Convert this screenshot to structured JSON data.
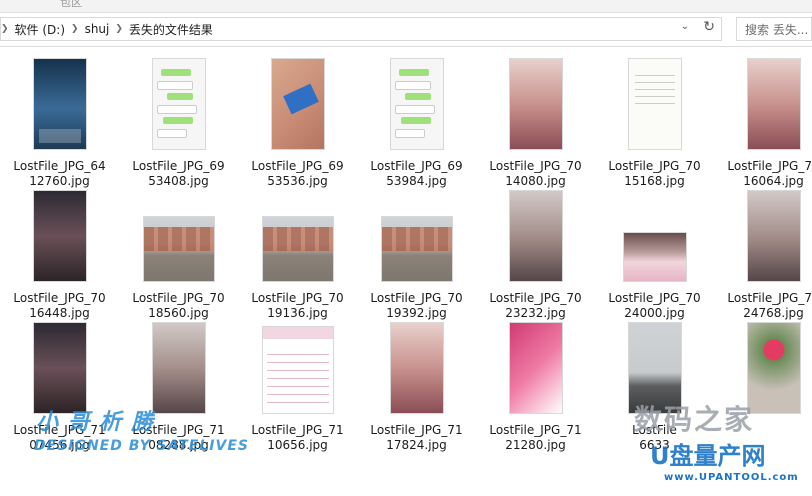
{
  "window": {
    "title_partial": "包区"
  },
  "address_bar": {
    "crumbs": [
      "软件 (D:)",
      "shuj",
      "丢失的文件结果"
    ],
    "dropdown_icon": "chevron-down-icon",
    "refresh_icon": "refresh-icon"
  },
  "search": {
    "placeholder": "搜索 丢失..."
  },
  "files": [
    {
      "line1": "LostFile_JPG_64",
      "line2": "12760.jpg",
      "art": "t-phone"
    },
    {
      "line1": "LostFile_JPG_69",
      "line2": "53408.jpg",
      "art": "t-chat"
    },
    {
      "line1": "LostFile_JPG_69",
      "line2": "53536.jpg",
      "art": "t-skin"
    },
    {
      "line1": "LostFile_JPG_69",
      "line2": "53984.jpg",
      "art": "t-chat"
    },
    {
      "line1": "LostFile_JPG_70",
      "line2": "14080.jpg",
      "art": "t-portrait"
    },
    {
      "line1": "LostFile_JPG_70",
      "line2": "15168.jpg",
      "art": "t-doc"
    },
    {
      "line1": "LostFile_JPG_70",
      "line2": "16064.jpg",
      "art": "t-portrait"
    },
    {
      "line1": "LostFile_JPG_70",
      "line2": "16448.jpg",
      "art": "t-dark"
    },
    {
      "line1": "LostFile_JPG_70",
      "line2": "18560.jpg",
      "art": "t-street"
    },
    {
      "line1": "LostFile_JPG_70",
      "line2": "19136.jpg",
      "art": "t-street"
    },
    {
      "line1": "LostFile_JPG_70",
      "line2": "19392.jpg",
      "art": "t-street"
    },
    {
      "line1": "LostFile_JPG_70",
      "line2": "23232.jpg",
      "art": "t-portrait2"
    },
    {
      "line1": "LostFile_JPG_70",
      "line2": "24000.jpg",
      "art": "t-kitty"
    },
    {
      "line1": "LostFile_JPG_70",
      "line2": "24768.jpg",
      "art": "t-portrait2"
    },
    {
      "line1": "LostFile_JPG_71",
      "line2": "07456.jpg",
      "art": "t-dark"
    },
    {
      "line1": "LostFile_JPG_71",
      "line2": "08288.jpg",
      "art": "t-portrait2"
    },
    {
      "line1": "LostFile_JPG_71",
      "line2": "10656.jpg",
      "art": "t-table"
    },
    {
      "line1": "LostFile_JPG_71",
      "line2": "17824.jpg",
      "art": "t-portrait"
    },
    {
      "line1": "LostFile_JPG_71",
      "line2": "21280.jpg",
      "art": "t-pink"
    },
    {
      "line1": "LostFile",
      "line2": "6633",
      "art": "t-road"
    },
    {
      "line1": "",
      "line2": "",
      "art": "t-flower"
    }
  ],
  "watermarks": {
    "left_line1": "小 哥 析 勝",
    "left_line2": "DESIGNED BY SATELIVES",
    "right_line1": "数码之家",
    "right_line2": "U盘量产网",
    "right_line3": "www.UPANTOOL.com"
  }
}
